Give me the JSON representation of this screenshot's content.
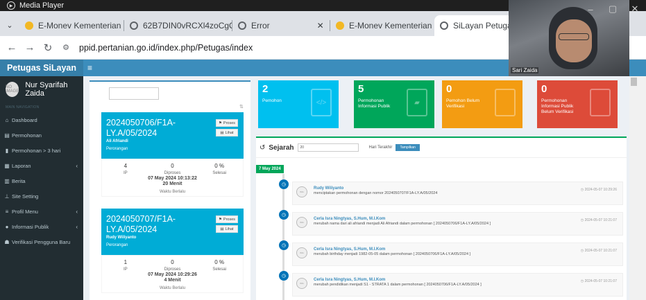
{
  "media_player": {
    "title": "Media Player"
  },
  "window_controls": {
    "minimize": "–",
    "maximize": "▢",
    "close": "✕"
  },
  "tabs": [
    {
      "label": "E-Monev Kementerian Pe",
      "icon_color": "#f2b824",
      "active": false
    },
    {
      "label": "62B7DIN0vRCXl4zoCgCz",
      "icon_color": "#5f6368",
      "active": false
    },
    {
      "label": "Error",
      "icon_color": "#5f6368",
      "active": false
    },
    {
      "label": "E-Monev Kementerian Pe",
      "icon_color": "#f2b824",
      "active": false
    },
    {
      "label": "SiLayan Petugas",
      "icon_color": "#5f6368",
      "active": true
    }
  ],
  "address_bar": {
    "url": "ppid.pertanian.go.id/index.php/Petugas/index"
  },
  "webcam": {
    "name": "Sari Zaida"
  },
  "app": {
    "brand": "Petugas SiLayan",
    "menu_toggle": "≡"
  },
  "sidebar": {
    "avatar": "NO IMAGE",
    "user_name": "Nur Syarifah Zaida",
    "nav_header": "MAIN NAVIGATION",
    "items": [
      {
        "label": "Dashboard",
        "icon": "home-icon"
      },
      {
        "label": "Permohonan",
        "icon": "file-icon"
      },
      {
        "label": "Permohonan > 3 hari",
        "icon": "bookmark-icon"
      },
      {
        "label": "Laporan",
        "icon": "calendar-icon",
        "caret": "‹"
      },
      {
        "label": "Berita",
        "icon": "newspaper-icon"
      },
      {
        "label": "Site Setting",
        "icon": "sitemap-icon"
      },
      {
        "label": "Profil Menu",
        "icon": "list-icon",
        "caret": "‹"
      },
      {
        "label": "Informasi Publik",
        "icon": "info-icon",
        "caret": "‹"
      },
      {
        "label": "Verifikasi Pengguna Baru",
        "icon": "users-icon"
      }
    ]
  },
  "request_list": {
    "search_value": "",
    "sort_icon": "sort-icon",
    "cards": [
      {
        "number": "2024050706/F1A-LY.A/05/2024",
        "name": "Ali Afriandi",
        "category": "Perorangan",
        "btn_process": "Proses",
        "btn_view": "Lihat",
        "stats": [
          {
            "value": "4",
            "label": "IP"
          },
          {
            "value": "0",
            "label": "Diproses"
          },
          {
            "value": "0 %",
            "label": "Selesai"
          }
        ],
        "datetime": "07 May 2024 10:13:22",
        "duration": "20 Menit",
        "time_label": "Waktu Berlalu"
      },
      {
        "number": "2024050707/F1A-LY.A/05/2024",
        "name": "Rudy Wiliyanto",
        "category": "Perorangan",
        "btn_process": "Proses",
        "btn_view": "Lihat",
        "stats": [
          {
            "value": "1",
            "label": "IP"
          },
          {
            "value": "0",
            "label": "Diproses"
          },
          {
            "value": "0 %",
            "label": "Selesai"
          }
        ],
        "datetime": "07 May 2024 10:29:26",
        "duration": "4 Menit",
        "time_label": "Waktu Berlalu"
      }
    ]
  },
  "info_boxes": [
    {
      "value": "2",
      "text": "Pemohon",
      "color": "#00c0ef",
      "icon": "code-file-icon"
    },
    {
      "value": "5",
      "text": "Permohonan Informasi Publik",
      "color": "#00a65a",
      "icon": "book-icon"
    },
    {
      "value": "0",
      "text": "Pemohon Belum Verifikasi",
      "color": "#f39c12",
      "icon": "file-icon"
    },
    {
      "value": "0",
      "text": "Permohonan Informasi Publik Belum Verifikasi",
      "color": "#dd4b39",
      "icon": "copy-icon"
    }
  ],
  "history": {
    "title": "Sejarah",
    "days_value": "20",
    "days_label": "Hari Terakhir",
    "show_button": "Tampilkan",
    "date_label": "7 May 2024",
    "entries": [
      {
        "who": "Rudy Wiliyanto",
        "what": "menciptakan permohonan dengan nomor 2024050707/F1A-LY.A/05/2024",
        "time": "2024-05-07 10:29:26"
      },
      {
        "who": "Cerla Isra Ningtyas, S.Hum, M.I.Kom",
        "what": "merubah nama dari ali afriandi menjadi Ali Afriandi dalam permohonan [ 2024050706/F1A-LY.A/05/2024 ]",
        "time": "2024-05-07 10:21:07"
      },
      {
        "who": "Cerla Isra Ningtyas, S.Hum, M.I.Kom",
        "what": "merubah birthday menjadi 1982-05-05 dalam permohonan [ 2024050706/F1A-LY.A/05/2024 ]",
        "time": "2024-05-07 10:21:07"
      },
      {
        "who": "Cerla Isra Ningtyas, S.Hum, M.I.Kom",
        "what": "merubah pendidikan menjadi S1 - STRATA 1 dalam permohonan [ 2024050706/F1A-LY.A/05/2024 ]",
        "time": "2024-05-07 10:21:07"
      }
    ]
  }
}
